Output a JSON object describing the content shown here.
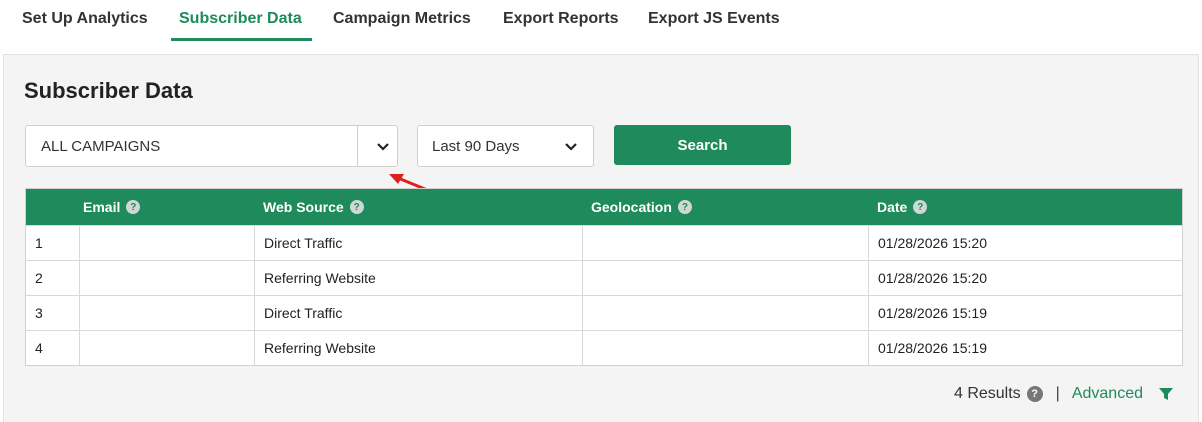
{
  "tabs": [
    {
      "label": "Set Up Analytics",
      "active": false
    },
    {
      "label": "Subscriber Data",
      "active": true
    },
    {
      "label": "Campaign Metrics",
      "active": false
    },
    {
      "label": "Export Reports",
      "active": false
    },
    {
      "label": "Export JS Events",
      "active": false
    }
  ],
  "panel": {
    "title": "Subscriber Data",
    "campaign_select": {
      "value": "ALL CAMPAIGNS",
      "icon": "chevron-down-icon"
    },
    "date_select": {
      "value": "Last 90 Days",
      "icon": "chevron-down-icon"
    },
    "search_label": "Search"
  },
  "table": {
    "headers": [
      "",
      "Email",
      "Web Source",
      "Geolocation",
      "Date"
    ],
    "help_icon": "?",
    "rows": [
      [
        "1",
        "",
        "Direct Traffic",
        "",
        "01/28/2026 15:20"
      ],
      [
        "2",
        "",
        "Referring Website",
        "",
        "01/28/2026 15:20"
      ],
      [
        "3",
        "",
        "Direct Traffic",
        "",
        "01/28/2026 15:19"
      ],
      [
        "4",
        "",
        "Referring Website",
        "",
        "01/28/2026 15:19"
      ]
    ]
  },
  "footer": {
    "results": "4 Results",
    "help_icon": "?",
    "separator": "|",
    "advanced_label": "Advanced",
    "filter_icon": "funnel-icon"
  },
  "colors": {
    "accent": "#1f8a5c",
    "annotation_arrow": "#e02020",
    "panel_bg": "#f4f4f4"
  }
}
